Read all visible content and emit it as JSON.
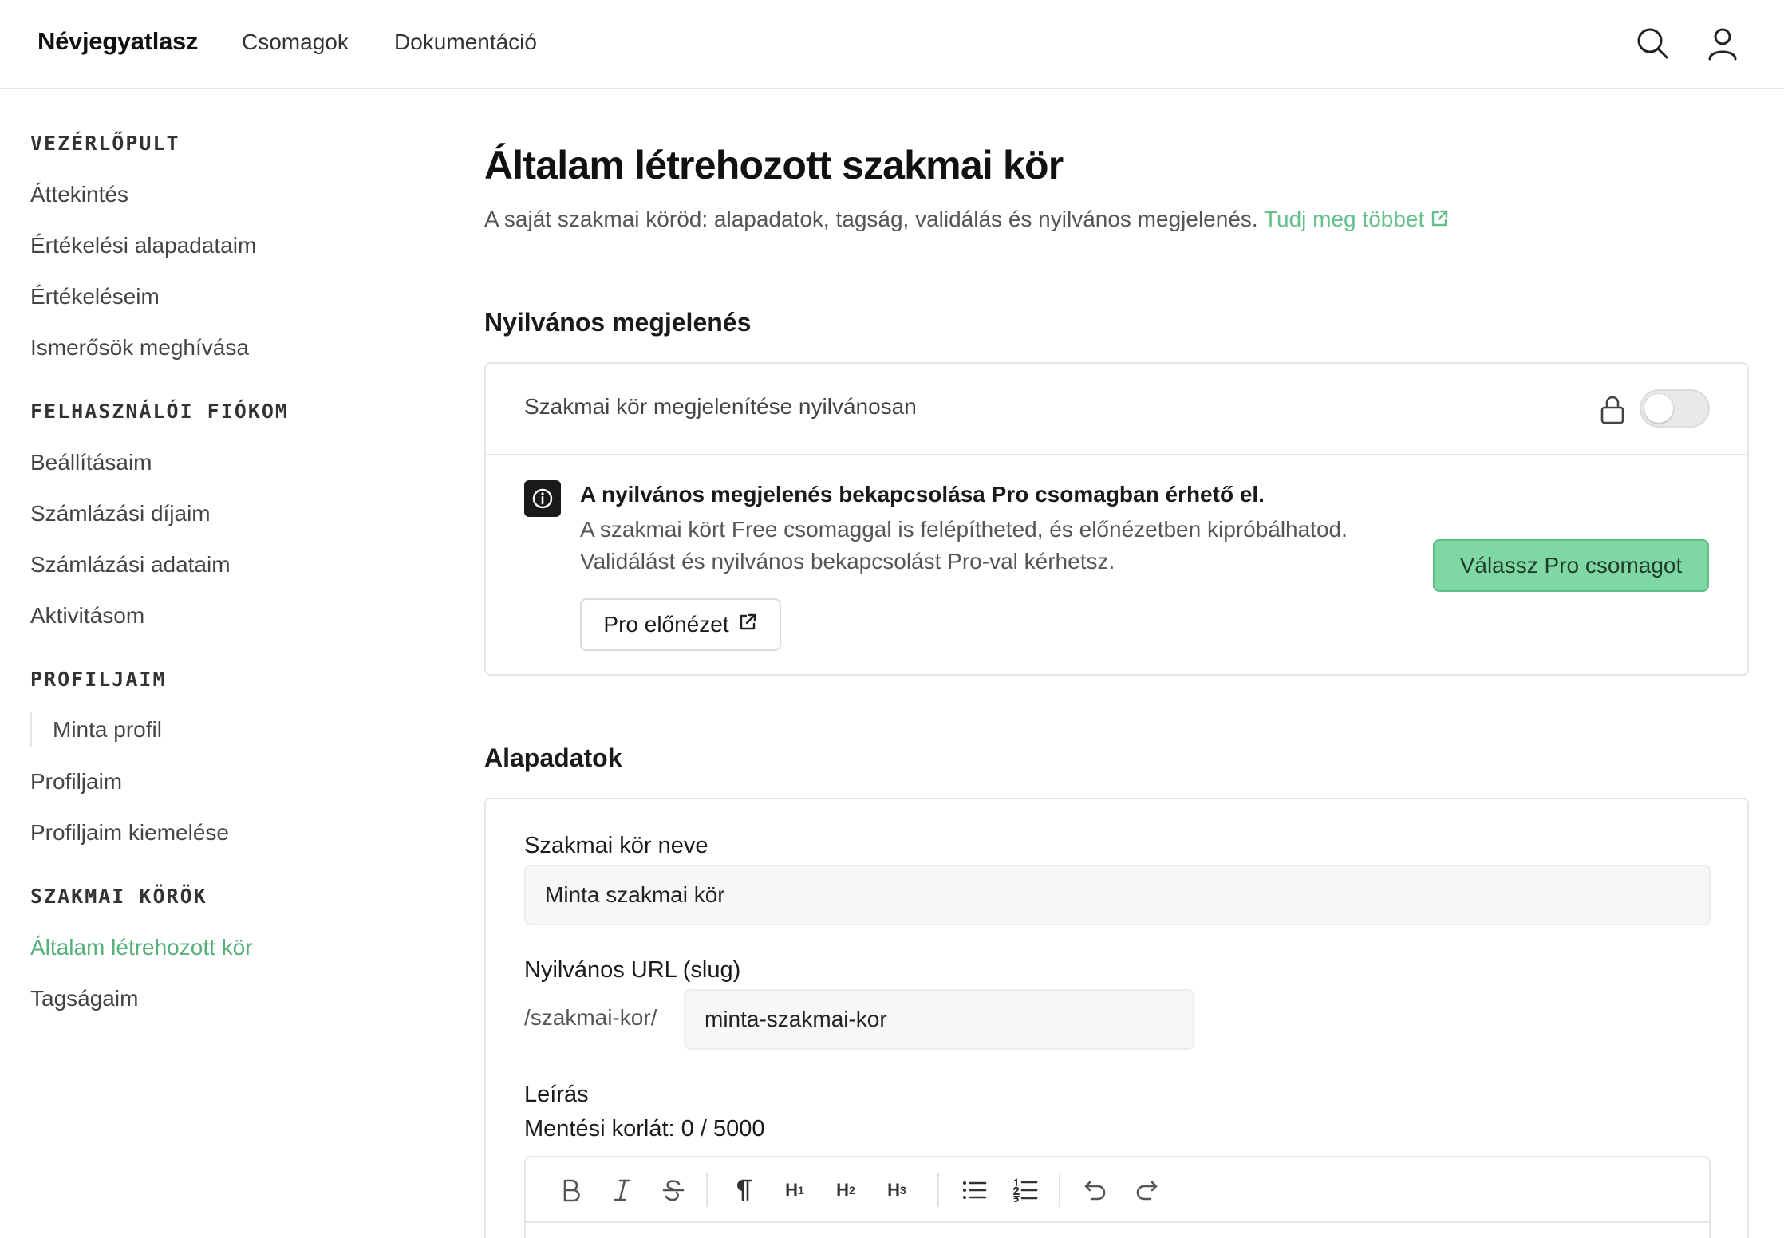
{
  "header": {
    "brand": "Névjegyatlasz",
    "nav": [
      "Csomagok",
      "Dokumentáció"
    ],
    "icons": [
      "search-icon",
      "user-icon"
    ]
  },
  "sidebar": {
    "sections": [
      {
        "title": "VEZÉRLŐPULT",
        "items": [
          "Áttekintés",
          "Értékelési alapadataim",
          "Értékeléseim",
          "Ismerősök meghívása"
        ]
      },
      {
        "title": "FELHASZNÁLÓI FIÓKOM",
        "items": [
          "Beállításaim",
          "Számlázási díjaim",
          "Számlázási adataim",
          "Aktivitásom"
        ]
      },
      {
        "title": "PROFILJAIM",
        "sub_items": [
          "Minta profil"
        ],
        "items": [
          "Profiljaim",
          "Profiljaim kiemelése"
        ]
      },
      {
        "title": "SZAKMAI KÖRÖK",
        "items": [
          "Általam létrehozott kör",
          "Tagságaim"
        ]
      }
    ],
    "active_item": "Általam létrehozott kör"
  },
  "main": {
    "title": "Általam létrehozott szakmai kör",
    "description": "A saját szakmai köröd: alapadatok, tagság, validálás és nyilvános megjelenés.",
    "learn_more": "Tudj meg többet",
    "public_section": {
      "title": "Nyilvános megjelenés",
      "toggle_label": "Szakmai kör megjelenítése nyilvánosan",
      "toggle_on": false,
      "info_title": "A nyilvános megjelenés bekapcsolása Pro csomagban érhető el.",
      "info_line1": "A szakmai kört Free csomaggal is felépítheted, és előnézetben kipróbálhatod.",
      "info_line2": "Validálást és nyilvános bekapcsolást Pro-val kérhetsz.",
      "preview_button": "Pro előnézet",
      "pro_button": "Válassz Pro csomagot"
    },
    "basic_section": {
      "title": "Alapadatok",
      "name_label": "Szakmai kör neve",
      "name_value": "Minta szakmai kör",
      "slug_label": "Nyilvános URL (slug)",
      "slug_prefix": "/szakmai-kor/",
      "slug_value": "minta-szakmai-kor",
      "description_label": "Leírás",
      "limit_label": "Mentési korlát:",
      "limit_value": "0 / 5000"
    },
    "toolbar": {
      "h1": "H",
      "h2": "H",
      "h3": "H",
      "h1_level": "1",
      "h2_level": "2",
      "h3_level": "3"
    }
  },
  "colors": {
    "accent": "#55b07a",
    "pro_button": "#7fd7a3",
    "dark": "#1a1a1a"
  }
}
